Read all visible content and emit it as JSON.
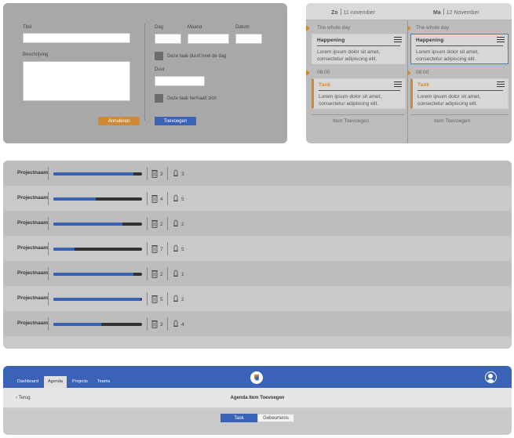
{
  "form": {
    "title_label": "Titel",
    "description_label": "Beschrijving",
    "day_label": "Dag",
    "month_label": "Maand",
    "date_label": "Datum",
    "allday_label": "Deze taak duurt heel de dag",
    "duration_label": "Duur",
    "repeat_label": "Deze taak herhaalt zich",
    "cancel_label": "Annuleren",
    "add_label": "Toevoegen"
  },
  "calendar": {
    "days": [
      {
        "day": "Zo",
        "date": "11 november",
        "allday_label": "The whole day",
        "time_label": "08:00",
        "event": {
          "title": "Happening",
          "text": "Lorem ipsum dolor sit amet, consectetur adipiscing elit."
        },
        "task": {
          "title": "Task",
          "text": "Lorem ipsum dolor sit amet, consectetur adipiscing elit."
        },
        "add_label": "Item Toevoegen"
      },
      {
        "day": "Ma",
        "date": "12 November",
        "allday_label": "The whole day",
        "time_label": "08:00",
        "event": {
          "title": "Happening",
          "text": "Lorem ipsum dolor sit amet, consectetur adipiscing elit."
        },
        "task": {
          "title": "Task",
          "text": "Lorem ipsum dolor sit amet, consectetur adipiscing elit."
        },
        "add_label": "Item Toevoegen"
      }
    ]
  },
  "projects": [
    {
      "name": "Projectnaam",
      "progress": 0.9,
      "tasks": "3",
      "members": "3"
    },
    {
      "name": "Projectnaam",
      "progress": 0.48,
      "tasks": "4",
      "members": "5"
    },
    {
      "name": "Projectnaam",
      "progress": 0.78,
      "tasks": "2",
      "members": "2"
    },
    {
      "name": "Projectnaam",
      "progress": 0.24,
      "tasks": "7",
      "members": "5"
    },
    {
      "name": "Projectnaam",
      "progress": 0.9,
      "tasks": "2",
      "members": "1"
    },
    {
      "name": "Projectnaam",
      "progress": 0.98,
      "tasks": "5",
      "members": "2"
    },
    {
      "name": "Projectnaam",
      "progress": 0.54,
      "tasks": "3",
      "members": "4"
    }
  ],
  "app": {
    "nav": [
      "Dashboard",
      "Agenda",
      "Projects",
      "Teams"
    ],
    "active_nav": "Agenda",
    "back_label": "Terug",
    "page_title": "Agenda Item Toevoegen",
    "tabs": [
      "Task",
      "Gebeurtenis"
    ],
    "active_tab": "Task"
  },
  "colors": {
    "accent_blue": "#3a62b6",
    "accent_orange": "#d08a36",
    "selection_blue": "#3a7fd0"
  }
}
